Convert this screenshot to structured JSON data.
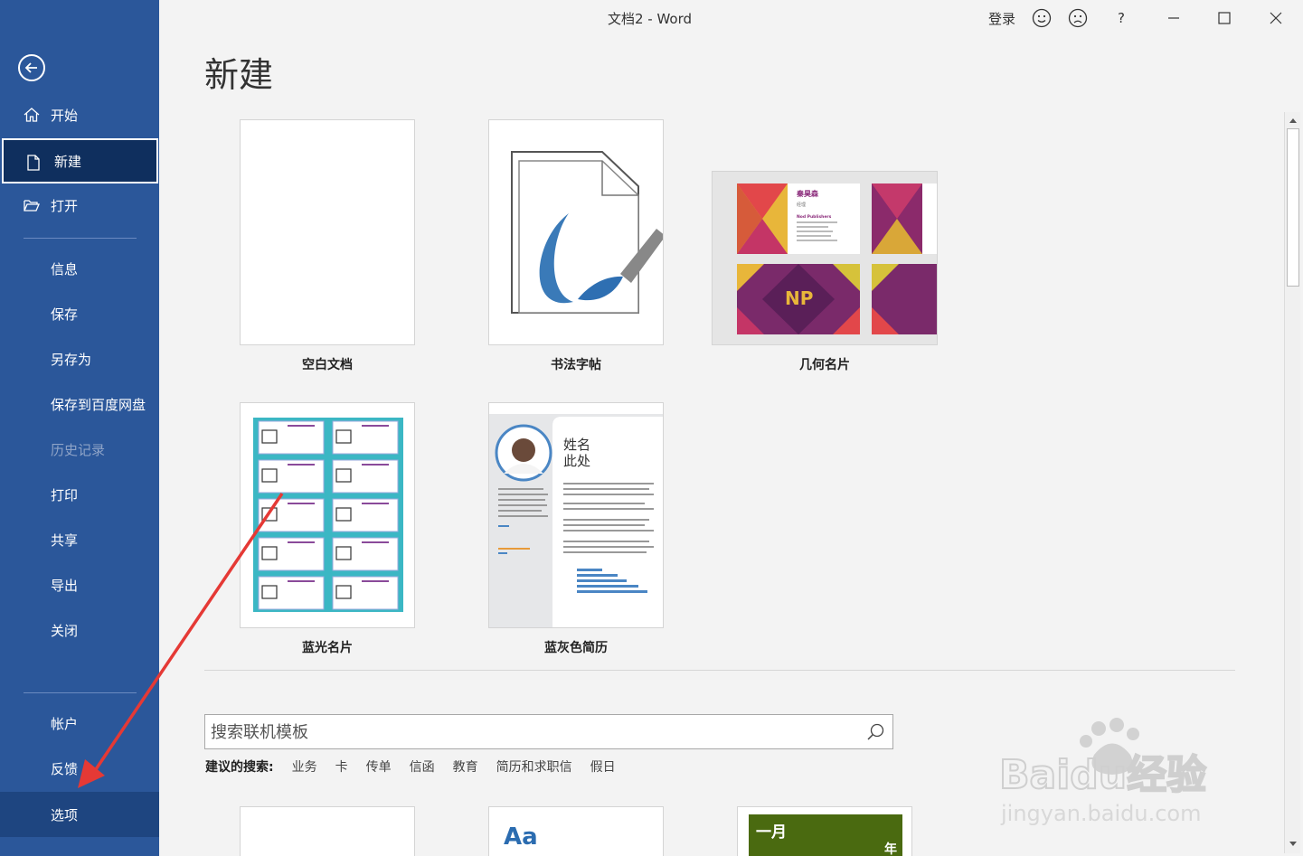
{
  "window": {
    "title": "文档2  -  Word",
    "sign_in": "登录",
    "help": "?"
  },
  "sidebar": {
    "items": [
      {
        "label": "开始"
      },
      {
        "label": "新建"
      },
      {
        "label": "打开"
      },
      {
        "label": "信息"
      },
      {
        "label": "保存"
      },
      {
        "label": "另存为"
      },
      {
        "label": "保存到百度网盘"
      },
      {
        "label": "历史记录"
      },
      {
        "label": "打印"
      },
      {
        "label": "共享"
      },
      {
        "label": "导出"
      },
      {
        "label": "关闭"
      },
      {
        "label": "帐户"
      },
      {
        "label": "反馈"
      },
      {
        "label": "选项"
      }
    ]
  },
  "page": {
    "heading": "新建"
  },
  "templates": [
    {
      "label": "空白文档"
    },
    {
      "label": "书法字帖"
    },
    {
      "label": "几何名片"
    },
    {
      "label": "蓝光名片"
    },
    {
      "label": "蓝灰色简历"
    }
  ],
  "thumbs": {
    "geo_name": "秦昊森",
    "geo_title": "经理",
    "geo_company": "Nod Publishers",
    "geo_logo": "NP",
    "resume_name_1": "姓名",
    "resume_name_2": "此处",
    "bottom_aa": "Aa",
    "bottom_month": "一月",
    "bottom_year": "年"
  },
  "search": {
    "placeholder": "搜索联机模板"
  },
  "suggested": {
    "label": "建议的搜索:",
    "links": [
      "业务",
      "卡",
      "传单",
      "信函",
      "教育",
      "简历和求职信",
      "假日"
    ]
  },
  "watermark": {
    "brand": "Baidu经验",
    "url": "jingyan.baidu.com"
  },
  "colors": {
    "sidebar": "#2b579a",
    "selected": "#0f2f5e",
    "arrow": "#e53935"
  }
}
